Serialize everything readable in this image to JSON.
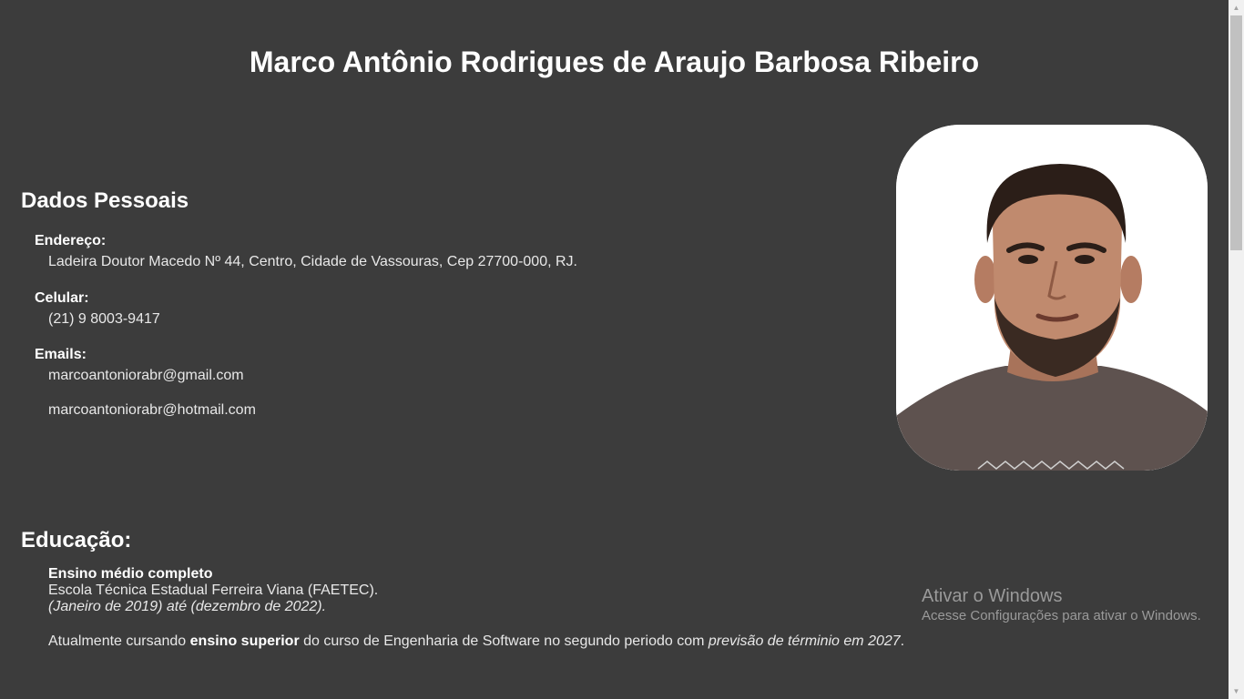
{
  "header": {
    "name": "Marco Antônio Rodrigues de Araujo Barbosa Ribeiro"
  },
  "personal": {
    "heading": "Dados Pessoais",
    "address_label": "Endereço:",
    "address": "Ladeira Doutor Macedo Nº 44, Centro, Cidade de Vassouras, Cep 27700-000, RJ.",
    "phone_label": "Celular:",
    "phone": "(21) 9 8003-9417",
    "emails_label": "Emails:",
    "emails": [
      "marcoantoniorabr@gmail.com",
      "marcoantoniorabr@hotmail.com"
    ]
  },
  "education": {
    "heading": "Educação:",
    "degree": "Ensino médio completo",
    "school": "Escola Técnica Estadual Ferreira Viana (FAETEC).",
    "period": "(Janeiro de 2019) até (dezembro de 2022).",
    "current_prefix": "Atualmente cursando ",
    "current_bold": "ensino superior",
    "current_middle": " do curso de Engenharia de Software no segundo periodo com ",
    "current_italic": "previsão de términio em 2027",
    "current_suffix": "."
  },
  "watermark": {
    "title": "Ativar o Windows",
    "subtitle": "Acesse Configurações para ativar o Windows."
  },
  "colors": {
    "background": "#3c3c3c",
    "text": "#ffffff",
    "watermark": "#9a9a9a",
    "photo_bg": "#ffffff",
    "shirt": "#5e524f",
    "skin": "#c08a6e"
  },
  "icons": {
    "scroll_up": "triangle-up-icon",
    "scroll_down": "triangle-down-icon"
  }
}
